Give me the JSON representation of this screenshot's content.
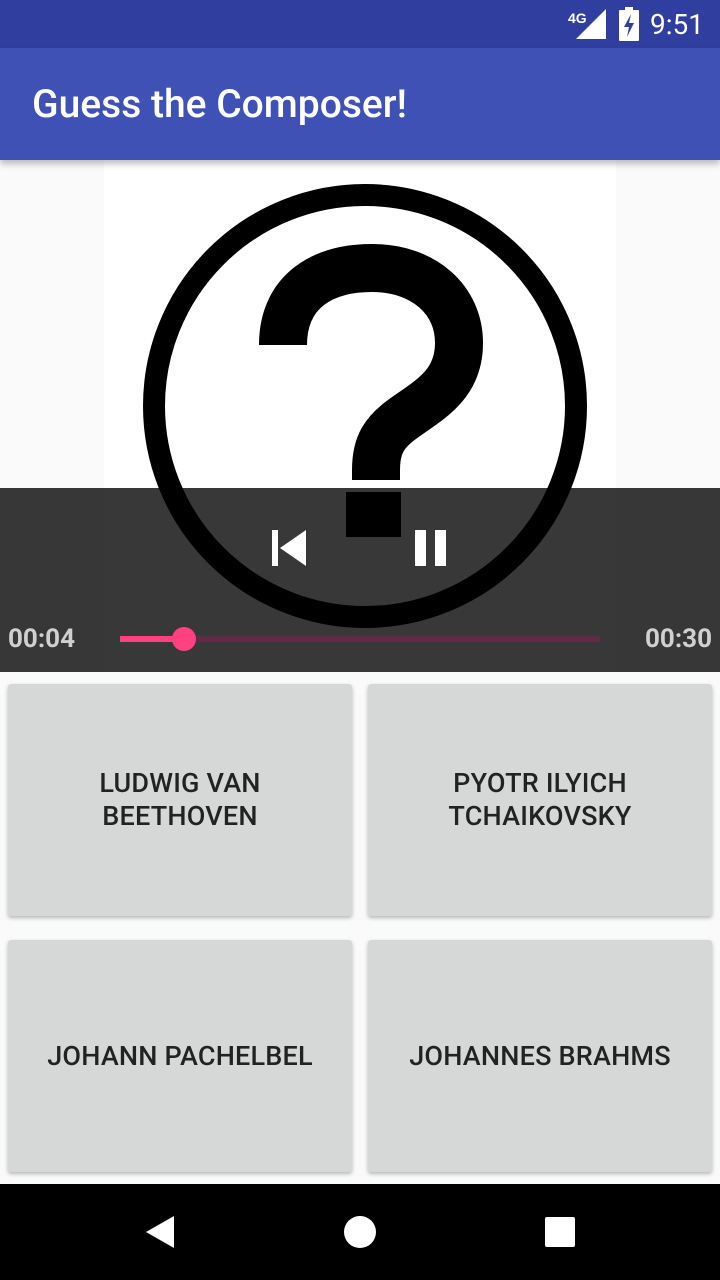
{
  "status_bar": {
    "network": "4G",
    "time": "9:51"
  },
  "app_bar": {
    "title": "Guess the Composer!"
  },
  "player": {
    "current_time": "00:04",
    "total_time": "00:30",
    "progress": 0.133
  },
  "answers": [
    "LUDWIG VAN BEETHOVEN",
    "PYOTR ILYICH TCHAIKOVSKY",
    "JOHANN PACHELBEL",
    "JOHANNES BRAHMS"
  ],
  "colors": {
    "status_bar": "#303f9f",
    "app_bar": "#3f51b5",
    "accent": "#ff4081",
    "answer_button": "#d6d7d7"
  },
  "icons": {
    "art": "question-mark-circle-icon",
    "prev": "skip-previous-icon",
    "pause": "pause-icon",
    "back": "back-icon",
    "home": "home-icon",
    "recents": "recents-icon",
    "signal": "signal-icon",
    "battery": "battery-charging-icon"
  }
}
